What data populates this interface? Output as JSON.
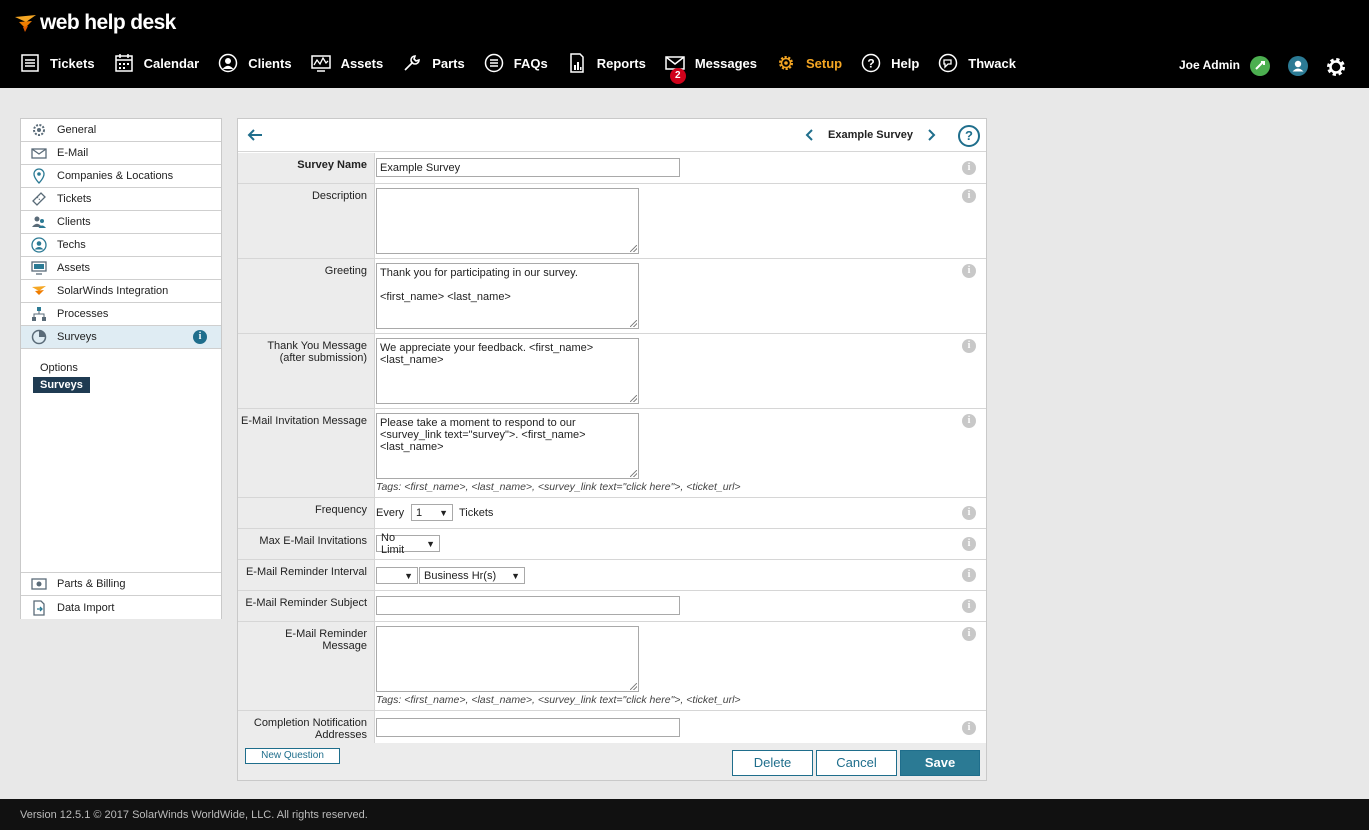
{
  "app": {
    "logo_text": "web help desk"
  },
  "nav": {
    "items": [
      {
        "label": "Tickets",
        "icon": "list-icon"
      },
      {
        "label": "Calendar",
        "icon": "calendar-icon"
      },
      {
        "label": "Clients",
        "icon": "person-icon"
      },
      {
        "label": "Assets",
        "icon": "monitor-chart-icon"
      },
      {
        "label": "Parts",
        "icon": "wrench-icon"
      },
      {
        "label": "FAQs",
        "icon": "faq-icon"
      },
      {
        "label": "Reports",
        "icon": "report-icon"
      },
      {
        "label": "Messages",
        "icon": "envelope-icon",
        "badge": "2"
      },
      {
        "label": "Setup",
        "icon": "gear-icon",
        "active": true
      },
      {
        "label": "Help",
        "icon": "question-icon"
      },
      {
        "label": "Thwack",
        "icon": "thwack-icon"
      }
    ],
    "user_name": "Joe Admin"
  },
  "sidebar": {
    "items": [
      {
        "label": "General"
      },
      {
        "label": "E-Mail"
      },
      {
        "label": "Companies & Locations"
      },
      {
        "label": "Tickets"
      },
      {
        "label": "Clients"
      },
      {
        "label": "Techs"
      },
      {
        "label": "Assets"
      },
      {
        "label": "SolarWinds Integration"
      },
      {
        "label": "Processes"
      },
      {
        "label": "Surveys",
        "active": true
      }
    ],
    "sub": [
      {
        "label": "Options"
      },
      {
        "label": "Surveys",
        "selected": true
      }
    ],
    "bottom": [
      {
        "label": "Parts & Billing"
      },
      {
        "label": "Data Import"
      }
    ]
  },
  "panel": {
    "survey_title": "Example Survey",
    "fields": {
      "survey_name": {
        "label": "Survey Name",
        "value": "Example Survey"
      },
      "description": {
        "label": "Description",
        "value": ""
      },
      "greeting": {
        "label": "Greeting",
        "value": "Thank you for participating in our survey.\n\n<first_name> <last_name>"
      },
      "thank_you": {
        "label": "Thank You Message",
        "label2": "(after submission)",
        "value": "We appreciate your feedback. <first_name>\n<last_name>"
      },
      "invitation": {
        "label": "E-Mail Invitation Message",
        "value": "Please take a moment to respond to our\n<survey_link text=\"survey\">. <first_name>\n<last_name>",
        "tags": "Tags: <first_name>, <last_name>, <survey_link text=\"click here\">, <ticket_url>"
      },
      "frequency": {
        "label": "Frequency",
        "prefix": "Every",
        "value": "1",
        "suffix": "Tickets"
      },
      "max_invitations": {
        "label": "Max E-Mail Invitations",
        "value": "No Limit"
      },
      "reminder_interval": {
        "label": "E-Mail Reminder Interval",
        "value": "",
        "unit": "Business Hr(s)"
      },
      "reminder_subject": {
        "label": "E-Mail Reminder Subject",
        "value": ""
      },
      "reminder_message": {
        "label": "E-Mail Reminder",
        "label2": "Message",
        "value": "",
        "tags": "Tags: <first_name>, <last_name>, <survey_link text=\"click here\">, <ticket_url>"
      },
      "completion": {
        "label": "Completion Notification",
        "label2": "Addresses",
        "value": ""
      }
    },
    "buttons": {
      "new_question": "New Question",
      "delete": "Delete",
      "cancel": "Cancel",
      "save": "Save"
    }
  },
  "footer": {
    "text": "Version 12.5.1 © 2017 SolarWinds WorldWide, LLC. All rights reserved."
  },
  "colors": {
    "accent": "#2b7a94",
    "active_nav": "#f5a623",
    "badge": "#d0021b"
  }
}
